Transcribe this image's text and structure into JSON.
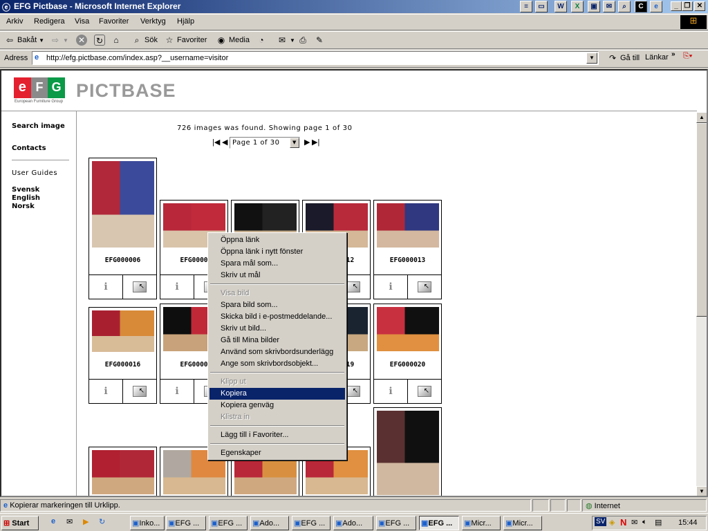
{
  "window": {
    "title": "EFG Pictbase - Microsoft Internet Explorer"
  },
  "menubar": [
    "Arkiv",
    "Redigera",
    "Visa",
    "Favoriter",
    "Verktyg",
    "Hjälp"
  ],
  "toolbar": {
    "back": "Bakåt",
    "search": "Sök",
    "favorites": "Favoriter",
    "media": "Media"
  },
  "address": {
    "label": "Adress",
    "url": "http://efg.pictbase.com/index.asp?__username=visitor",
    "go": "Gå till",
    "links": "Länkar"
  },
  "header": {
    "logo_letters": "eFG",
    "logo_sub": "European Furniture Group",
    "title": "PICTBASE"
  },
  "sidebar": {
    "search": "Search image",
    "contacts": "Contacts",
    "guides": "User Guides",
    "languages": [
      "Svensk",
      "English",
      "Norsk"
    ]
  },
  "results": {
    "summary": "726 images was found. Showing page 1 of 30",
    "page_select": "Page 1 of 30"
  },
  "cards": [
    {
      "id": "EFG000006",
      "colors": [
        "#b0283a",
        "#3b4a9a",
        "#d8c6b0"
      ]
    },
    {
      "id": "EFG0000",
      "colors": [
        "#b8283a",
        "#c02a3a",
        "#d9c4aa"
      ]
    },
    {
      "id": "",
      "colors": [
        "#111",
        "#222",
        "#c8b090"
      ]
    },
    {
      "id": "EFG000012",
      "colors": [
        "#1a1a2a",
        "#b82a3a",
        "#d4b898"
      ]
    },
    {
      "id": "EFG000013",
      "colors": [
        "#b02838",
        "#303880",
        "#d4b8a0"
      ]
    },
    {
      "id": "EFG000016",
      "colors": [
        "#a82030",
        "#d88a38",
        "#d8bc98"
      ]
    },
    {
      "id": "EFG0000",
      "colors": [
        "#0e0e0e",
        "#c02838",
        "#c8a27a"
      ]
    },
    {
      "id": "",
      "colors": [
        "#222",
        "#b02838",
        "#d0b090"
      ]
    },
    {
      "id": "EFG000019",
      "colors": [
        "#101820",
        "#1a2430",
        "#c8a880"
      ]
    },
    {
      "id": "EFG000020",
      "colors": [
        "#c83040",
        "#101010",
        "#e09040"
      ]
    },
    {
      "id": "",
      "colors": [
        "#b02030",
        "#b02838",
        "#d0a880"
      ]
    },
    {
      "id": "",
      "colors": [
        "#b0a8a0",
        "#e08840",
        "#d8b890"
      ]
    },
    {
      "id": "",
      "colors": [
        "#b82838",
        "#d89040",
        "#d0a880"
      ]
    },
    {
      "id": "",
      "colors": [
        "#b82838",
        "#e09040",
        "#d8b890"
      ]
    },
    {
      "id": "",
      "colors": [
        "#5a3030",
        "#101010",
        "#d0b8a0"
      ]
    }
  ],
  "context_menu": [
    {
      "label": "Öppna länk"
    },
    {
      "label": "Öppna länk i nytt fönster"
    },
    {
      "label": "Spara mål som..."
    },
    {
      "label": "Skriv ut mål"
    },
    {
      "sep": true
    },
    {
      "label": "Visa bild",
      "disabled": true
    },
    {
      "label": "Spara bild som..."
    },
    {
      "label": "Skicka bild i e-postmeddelande..."
    },
    {
      "label": "Skriv ut bild..."
    },
    {
      "label": "Gå till Mina bilder"
    },
    {
      "label": "Använd som skrivbordsunderlägg"
    },
    {
      "label": "Ange som skrivbordsobjekt..."
    },
    {
      "sep": true
    },
    {
      "label": "Klipp ut",
      "disabled": true
    },
    {
      "label": "Kopiera",
      "selected": true
    },
    {
      "label": "Kopiera genväg"
    },
    {
      "label": "Klistra in",
      "disabled": true
    },
    {
      "sep": true
    },
    {
      "label": "Lägg till i Favoriter..."
    },
    {
      "sep": true
    },
    {
      "label": "Egenskaper"
    }
  ],
  "statusbar": {
    "text": "Kopierar markeringen till Urklipp.",
    "zone": "Internet"
  },
  "taskbar": {
    "start": "Start",
    "tasks": [
      "Inko...",
      "EFG ...",
      "EFG ...",
      "Ado...",
      "EFG ...",
      "Ado...",
      "EFG ...",
      "EFG ...",
      "Micr...",
      "Micr..."
    ],
    "active_index": 7,
    "lang": "SV",
    "clock": "15:44"
  },
  "colors": {
    "titlebar": "#0a246a",
    "selection": "#0a246a",
    "logo_red": "#e4202e",
    "logo_gray": "#8a8a8a",
    "logo_green": "#0a9a48"
  }
}
